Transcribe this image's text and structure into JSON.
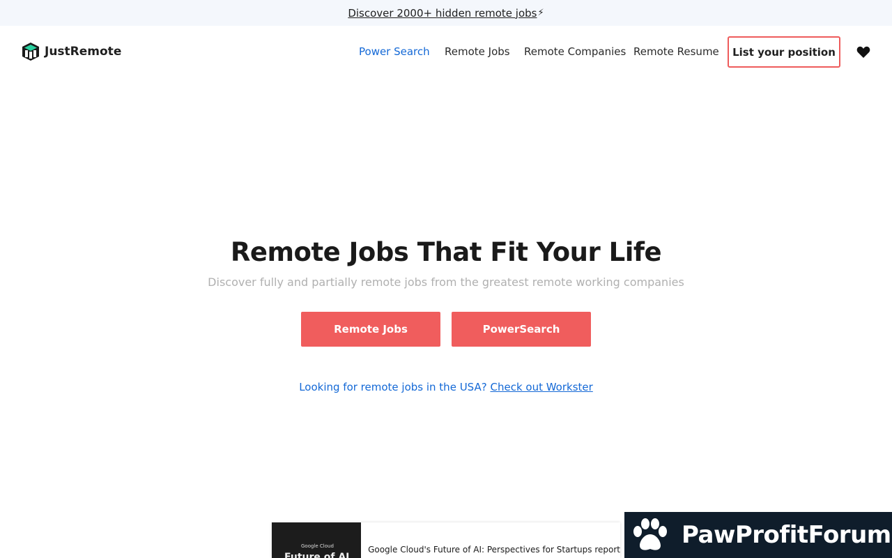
{
  "announcement": {
    "text": "Discover 2000+ hidden remote jobs",
    "bolt": "⚡"
  },
  "header": {
    "logo_text": "JustRemote",
    "nav": [
      {
        "label": "Power Search",
        "active": true
      },
      {
        "label": "Remote Jobs",
        "active": false
      },
      {
        "label": "Remote Companies",
        "active": false
      },
      {
        "label": "Remote Resume",
        "active": false
      }
    ],
    "list_button": "List your position",
    "favorites_icon": "heart-icon"
  },
  "hero": {
    "title": "Remote Jobs That Fit Your Life",
    "subtitle": "Discover fully and partially remote jobs from the greatest remote working companies",
    "buttons": [
      "Remote Jobs",
      "PowerSearch"
    ],
    "usa_prefix": "Looking for remote jobs in the USA?",
    "usa_link": "Check out Workster"
  },
  "ad": {
    "thumb_brand": "Google Cloud",
    "thumb_title": "Future of AI",
    "text": "Google Cloud's Future of AI: Perspectives for Startups report"
  },
  "watermark": {
    "text": "PawProfitForum",
    "icon": "paw-icon"
  },
  "colors": {
    "accent_red": "#f05d5d",
    "link_blue": "#1368d6",
    "watermark_bg": "#0f1d2b"
  }
}
